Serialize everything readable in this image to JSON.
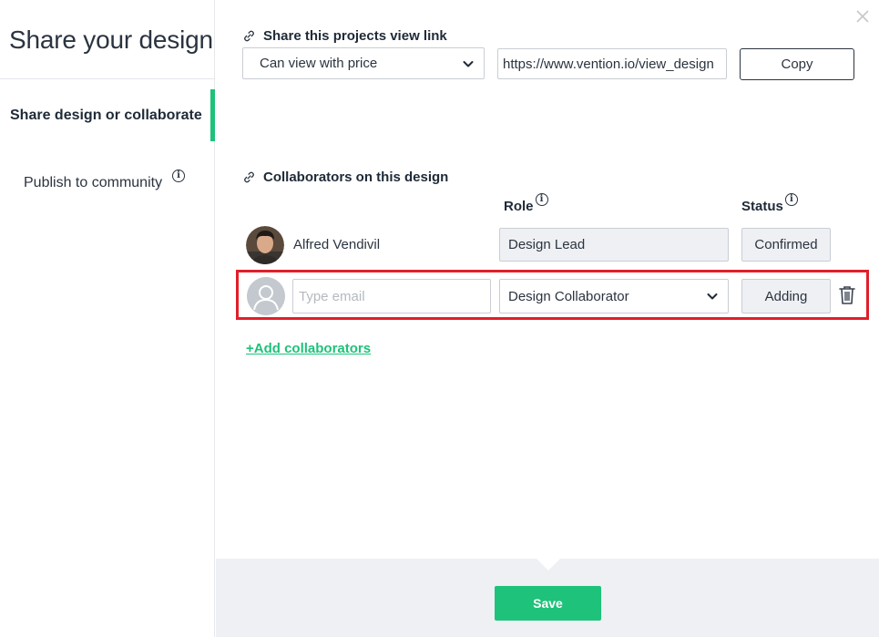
{
  "sidebar": {
    "title": "Share your design",
    "items": [
      {
        "label": "Share design or collaborate",
        "active": true
      },
      {
        "label": "Publish to community",
        "icon": "info-icon"
      }
    ]
  },
  "share_link": {
    "heading": "Share this projects view link",
    "permission_selected": "Can view with price",
    "url": "https://www.vention.io/view_design",
    "copy_label": "Copy"
  },
  "collaborators": {
    "heading": "Collaborators on this design",
    "role_header": "Role",
    "status_header": "Status",
    "rows": [
      {
        "name": "Alfred Vendivil",
        "role": "Design Lead",
        "status": "Confirmed"
      }
    ],
    "new_row": {
      "email_value": "",
      "email_placeholder": "Type email",
      "role_selected": "Design Collaborator",
      "status": "Adding"
    },
    "add_label": "+Add collaborators"
  },
  "footer": {
    "save_label": "Save"
  },
  "colors": {
    "accent": "#1ec27a",
    "highlight": "#e01f2a",
    "text": "#1f2a37",
    "footer_bg": "#eef0f4"
  }
}
